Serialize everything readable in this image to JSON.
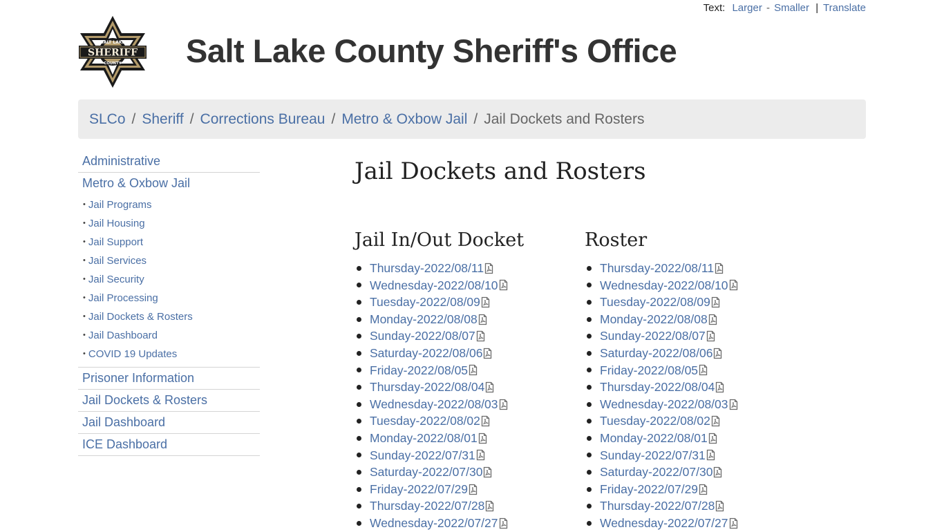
{
  "utility_bar": {
    "text_label": "Text:",
    "larger": "Larger",
    "dash": "-",
    "smaller": "Smaller",
    "pipe": "|",
    "translate": "Translate"
  },
  "header": {
    "logo": {
      "top_text": "SALT LAKE",
      "main_text": "SHERIFF",
      "bottom_text": "COUNTY"
    },
    "title": "Salt Lake County Sheriff's Office"
  },
  "breadcrumb": {
    "items": [
      "SLCo",
      "Sheriff",
      "Corrections Bureau",
      "Metro & Oxbow Jail"
    ],
    "separator": "/",
    "current": "Jail Dockets and Rosters"
  },
  "sidebar": {
    "items": [
      {
        "label": "Administrative"
      },
      {
        "label": "Metro & Oxbow Jail"
      }
    ],
    "sub_items": [
      {
        "label": "Jail Programs"
      },
      {
        "label": "Jail Housing"
      },
      {
        "label": "Jail Support"
      },
      {
        "label": "Jail Services"
      },
      {
        "label": "Jail Security"
      },
      {
        "label": "Jail Processing"
      },
      {
        "label": "Jail Dockets & Rosters"
      },
      {
        "label": "Jail Dashboard"
      },
      {
        "label": "COVID 19 Updates"
      }
    ],
    "sub_bullet": "•",
    "bottom_items": [
      {
        "label": "Prisoner Information"
      },
      {
        "label": "Jail Dockets & Rosters"
      },
      {
        "label": "Jail Dashboard"
      },
      {
        "label": "ICE Dashboard"
      }
    ]
  },
  "main": {
    "title": "Jail Dockets and Rosters",
    "docket": {
      "heading": "Jail In/Out Docket",
      "items": [
        "Thursday-2022/08/11",
        "Wednesday-2022/08/10",
        "Tuesday-2022/08/09",
        "Monday-2022/08/08",
        "Sunday-2022/08/07",
        "Saturday-2022/08/06",
        "Friday-2022/08/05",
        "Thursday-2022/08/04",
        "Wednesday-2022/08/03",
        "Tuesday-2022/08/02",
        "Monday-2022/08/01",
        "Sunday-2022/07/31",
        "Saturday-2022/07/30",
        "Friday-2022/07/29",
        "Thursday-2022/07/28",
        "Wednesday-2022/07/27"
      ]
    },
    "roster": {
      "heading": "Roster",
      "items": [
        "Thursday-2022/08/11",
        "Wednesday-2022/08/10",
        "Tuesday-2022/08/09",
        "Monday-2022/08/08",
        "Sunday-2022/08/07",
        "Saturday-2022/08/06",
        "Friday-2022/08/05",
        "Thursday-2022/08/04",
        "Wednesday-2022/08/03",
        "Tuesday-2022/08/02",
        "Monday-2022/08/01",
        "Sunday-2022/07/31",
        "Saturday-2022/07/30",
        "Friday-2022/07/29",
        "Thursday-2022/07/28",
        "Wednesday-2022/07/27"
      ]
    },
    "item_icon": "pdf-file-icon"
  },
  "colors": {
    "link": "#4a6fa5",
    "breadcrumb_bg": "#ececec",
    "logo_gold": "#b39b6b",
    "logo_black": "#1a1a1a"
  }
}
